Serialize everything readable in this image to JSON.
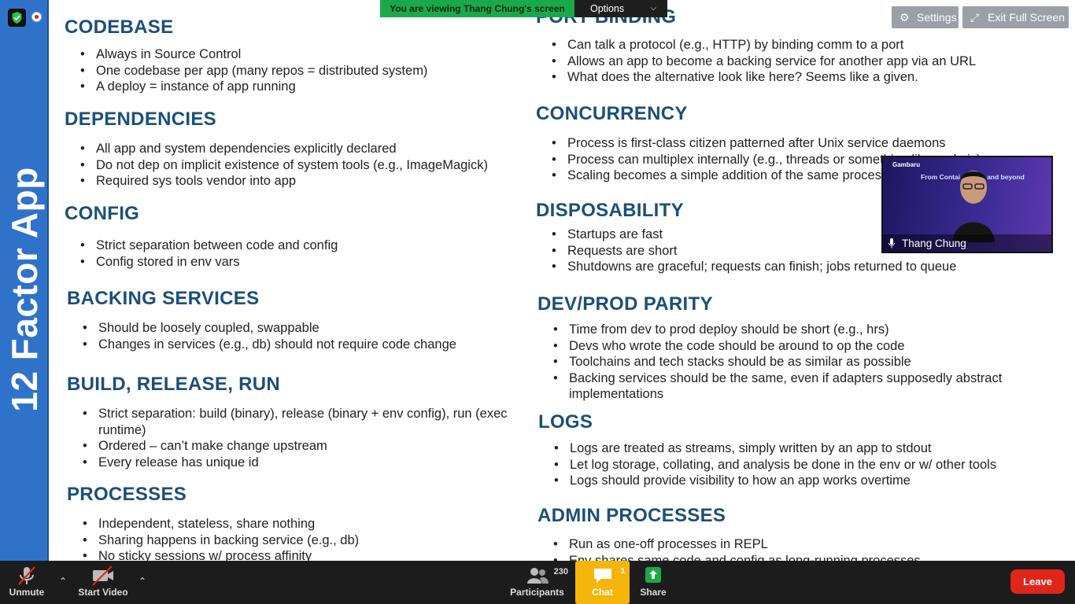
{
  "slide": {
    "sidebar_title": "12 Factor App",
    "sections": [
      {
        "title": "CODEBASE",
        "bullets": [
          "Always in Source Control",
          "One codebase per app (many repos = distributed system)",
          "A deploy = instance of app running"
        ]
      },
      {
        "title": "DEPENDENCIES",
        "bullets": [
          "All app and system dependencies explicitly declared",
          "Do not dep on implicit existence of system tools (e.g., ImageMagick)",
          "Required sys tools vendor into app"
        ]
      },
      {
        "title": "CONFIG",
        "bullets": [
          "Strict separation between code and config",
          "Config stored in env vars"
        ]
      },
      {
        "title": "BACKING SERVICES",
        "bullets": [
          "Should be loosely coupled, swappable",
          "Changes in services (e.g., db) should not require code change"
        ]
      },
      {
        "title": "BUILD, RELEASE, RUN",
        "bullets": [
          "Strict separation: build (binary), release (binary + env config), run (exec runtime)",
          "Ordered – can’t make change upstream",
          "Every release has unique id"
        ]
      },
      {
        "title": "PROCESSES",
        "bullets": [
          "Independent, stateless, share nothing",
          "Sharing happens in backing service (e.g., db)",
          "No sticky sessions w/ process affinity"
        ]
      },
      {
        "title": "PORT BINDING",
        "bullets": [
          "Can talk a protocol (e.g., HTTP) by binding comm to a port",
          "Allows an app to become a backing service for another app via an URL",
          "What does the alternative look like here? Seems like a given."
        ]
      },
      {
        "title": "CONCURRENCY",
        "bullets": [
          "Process is first-class citizen patterned after Unix service daemons",
          "Process can multiplex internally (e.g., threads or something like node.js)",
          "Scaling becomes a simple addition of the same process"
        ]
      },
      {
        "title": "DISPOSABILITY",
        "bullets": [
          "Startups are fast",
          "Requests are short",
          "Shutdowns are graceful; requests can finish; jobs returned to queue"
        ]
      },
      {
        "title": "DEV/PROD PARITY",
        "bullets": [
          "Time from dev to prod deploy should be short (e.g., hrs)",
          "Devs who wrote the code should be around to op the code",
          "Toolchains and tech stacks should be as similar as possible",
          "Backing services should be the same, even if adapters supposedly abstract implementations"
        ]
      },
      {
        "title": "LOGS",
        "bullets": [
          "Logs are treated as streams, simply written by an app to stdout",
          "Let log storage, collating, and analysis be done in the env or w/ other tools",
          "Logs should provide visibility to how an app works overtime"
        ]
      },
      {
        "title": "ADMIN PROCESSES",
        "bullets": [
          "Run as one-off processes in REPL",
          "Env shares same code and config as long-running processes"
        ]
      }
    ]
  },
  "banner": {
    "text": "You are viewing Thang Chung's screen",
    "options_label": "Options"
  },
  "top_buttons": {
    "settings": "Settings",
    "exit_fullscreen": "Exit Full Screen"
  },
  "video": {
    "name": "Thang Chung",
    "logo": "Gambaru",
    "headline": "From Contai...netes, and beyond"
  },
  "toolbar": {
    "unmute": "Unmute",
    "start_video": "Start Video",
    "participants": "Participants",
    "participants_count": "230",
    "chat": "Chat",
    "chat_count": "1",
    "share": "Share",
    "leave": "Leave"
  },
  "colors": {
    "sidebar": "#2f72c9",
    "heading": "#1b4f78",
    "banner": "#1aa94a",
    "chat": "#f5b50a",
    "leave": "#e0261b"
  }
}
